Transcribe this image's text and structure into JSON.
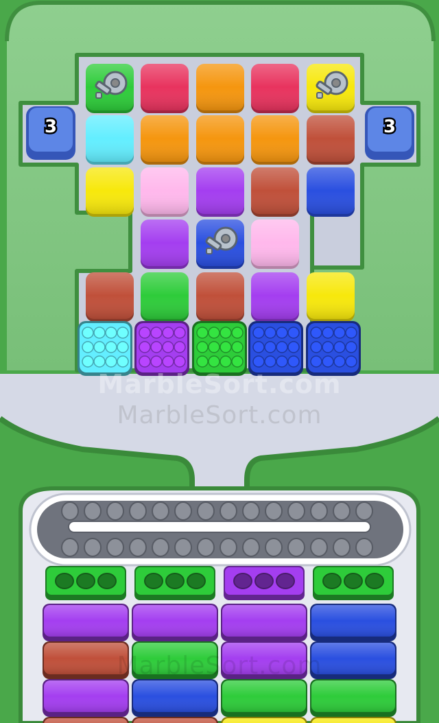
{
  "board": {
    "grid": [
      [
        "green-key",
        "crimson",
        "orange",
        "crimson",
        "yellow-key"
      ],
      [
        "cyan",
        "orange",
        "orange",
        "orange",
        "brick"
      ],
      [
        "yellow",
        "pink",
        "purple",
        "brick",
        "blue"
      ],
      [
        null,
        "purple",
        "blue-key",
        "pink",
        null
      ],
      [
        "brick",
        "green",
        "brick",
        "purple",
        "yellow"
      ]
    ],
    "bottom_row": [
      "cyan",
      "purple",
      "green",
      "blue",
      "blue"
    ],
    "side_counters": [
      {
        "side": "left",
        "value": "3"
      },
      {
        "side": "right",
        "value": "3"
      }
    ]
  },
  "colors": {
    "green": "#2ecc3a",
    "crimson": "#e8335e",
    "orange": "#f5960f",
    "yellow": "#f7e80c",
    "cyan": "#63eeff",
    "brick": "#c0503a",
    "pink": "#ffb8ec",
    "purple": "#a43ef0",
    "blue": "#2a4fe0"
  },
  "conveyor": {
    "slots": 28
  },
  "trays": [
    [
      "green",
      "purple",
      "brick",
      "purple",
      "brick"
    ],
    [
      "green",
      "purple",
      "green",
      "blue",
      "brick"
    ],
    [
      "purple",
      "purple",
      "purple",
      "green",
      "yellow"
    ],
    [
      "green",
      "blue",
      "blue",
      "green",
      "yellow"
    ]
  ],
  "watermarks": [
    "MarbleSort.com",
    "MarbleSort.com",
    "MarbleSort.com"
  ]
}
